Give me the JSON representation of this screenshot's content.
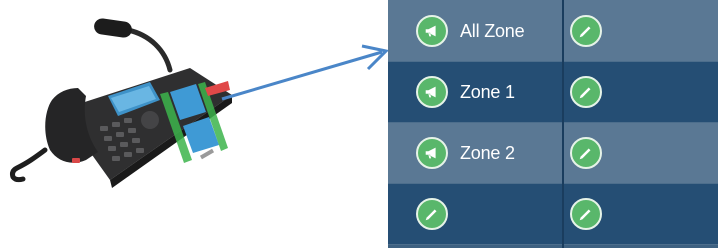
{
  "panel": {
    "rows": [
      {
        "label": "All Zone"
      },
      {
        "label": "Zone 1"
      },
      {
        "label": "Zone 2"
      },
      {
        "label": ""
      }
    ]
  },
  "icons": {
    "page_button": "megaphone-icon",
    "edit_button": "pencil-icon"
  },
  "colors": {
    "arrow": "#4a86c8",
    "button_green": "#59b76b",
    "row_light": "#5a7894",
    "row_dark": "#254e74"
  }
}
